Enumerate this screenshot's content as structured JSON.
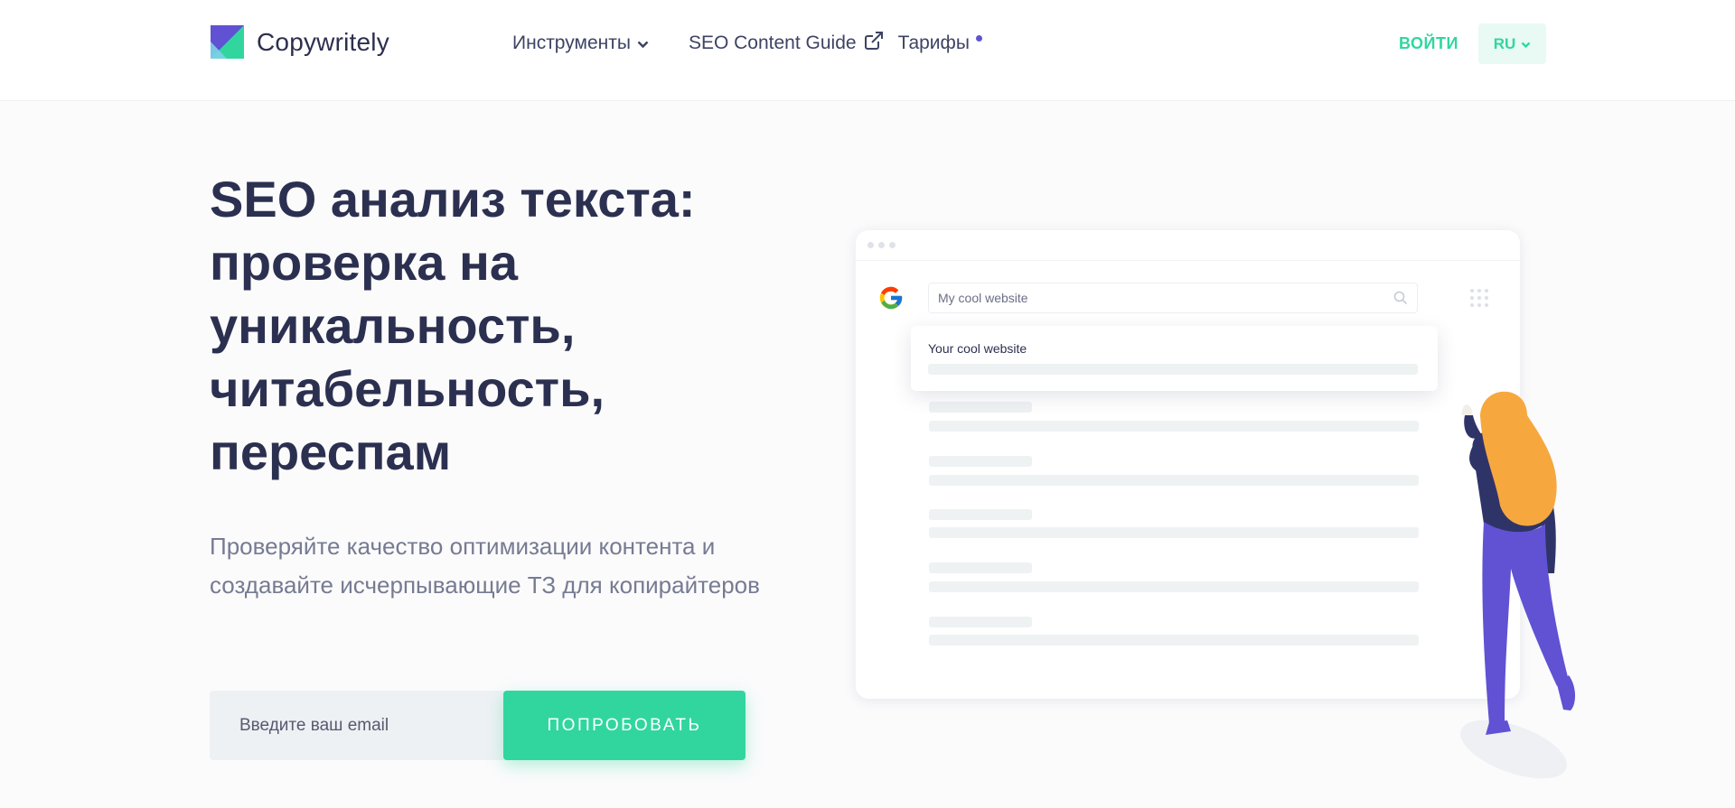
{
  "colors": {
    "accent": "#31d69f",
    "accent_bg": "#e8faf3",
    "heading": "#2c3050",
    "purple": "#6052d3",
    "navy": "#2f3468",
    "orange": "#f6a83f"
  },
  "header": {
    "brand": "Copywritely",
    "nav": [
      {
        "label": "Инструменты",
        "icon": "chevron-down-icon"
      },
      {
        "label": "SEO Content Guide",
        "icon": "external-link-icon"
      },
      {
        "label": "Тарифы",
        "icon": "dot"
      }
    ],
    "login": "ВОЙТИ",
    "lang": "RU"
  },
  "hero": {
    "title_lines": [
      "SEO анализ текста:",
      "проверка на",
      "уникальность,",
      "читабельность,",
      "переспам"
    ],
    "subtitle": "Проверяйте качество оптимизации контента и создавайте исчерпывающие ТЗ для копирайтеров",
    "email_placeholder": "Введите ваш email",
    "cta": "ПОПРОБОВАТЬ"
  },
  "illustration": {
    "search_query": "My cool website",
    "result_title": "Your cool website"
  }
}
